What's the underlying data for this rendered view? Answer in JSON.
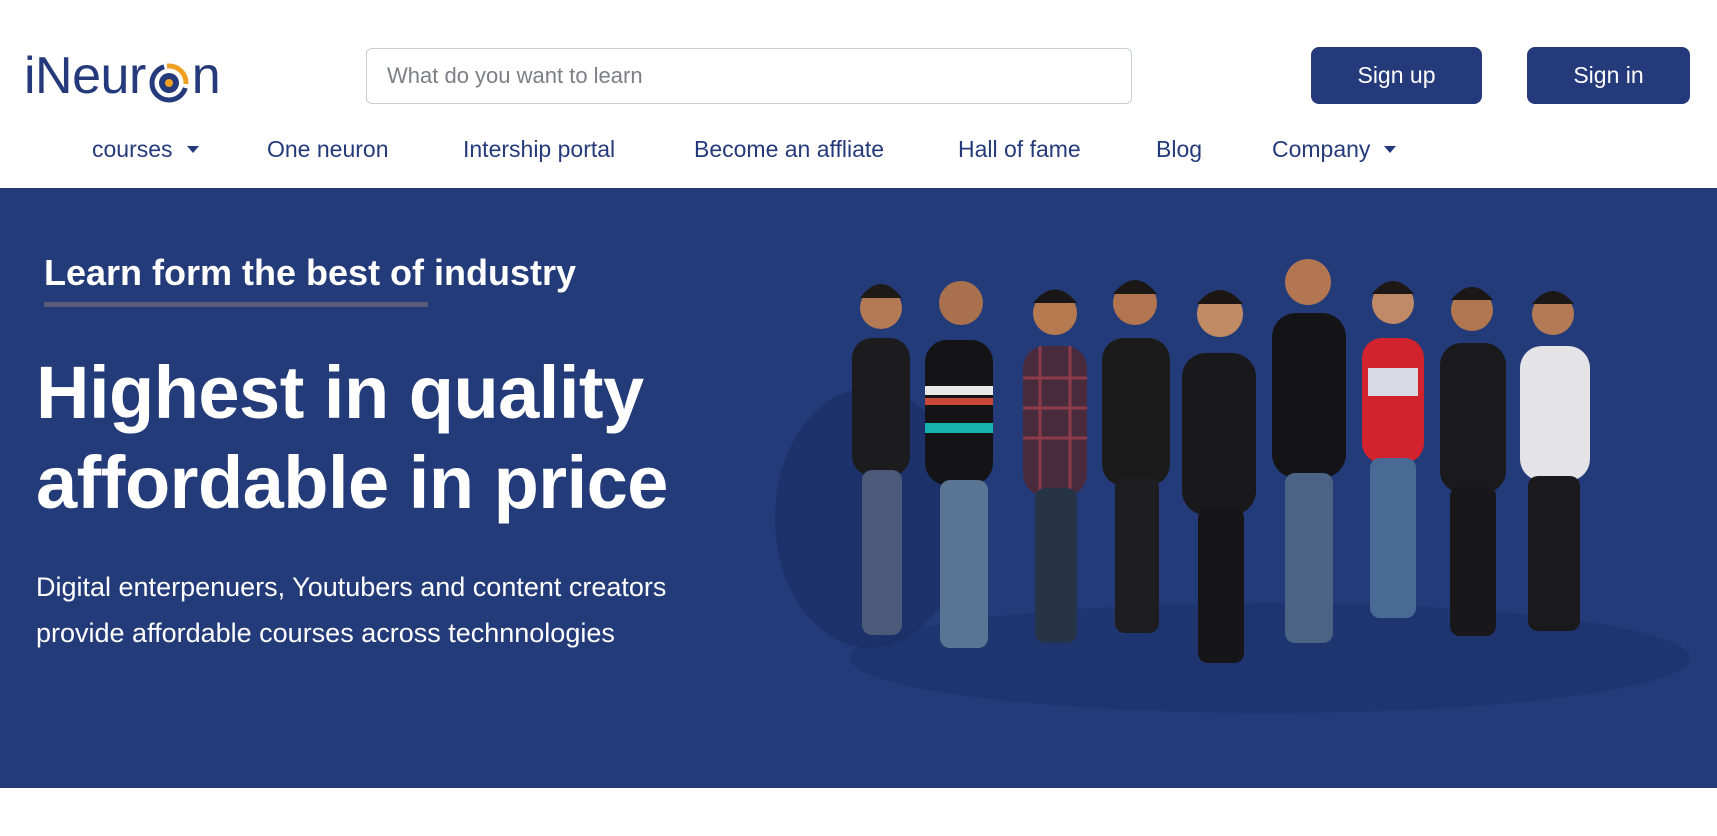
{
  "header": {
    "logo_text_prefix": "iNeur",
    "logo_text_suffix": "n",
    "search_placeholder": "What do you want to learn",
    "signup_label": "Sign up",
    "signin_label": "Sign in"
  },
  "nav": {
    "items": [
      {
        "label": "courses",
        "dropdown": true
      },
      {
        "label": "One neuron",
        "dropdown": false
      },
      {
        "label": "Intership portal",
        "dropdown": false
      },
      {
        "label": "Become an affliate",
        "dropdown": false
      },
      {
        "label": "Hall of fame",
        "dropdown": false
      },
      {
        "label": "Blog",
        "dropdown": false
      },
      {
        "label": "Company",
        "dropdown": true
      }
    ]
  },
  "hero": {
    "eyebrow": "Learn form the best of industry",
    "headline_line1": "Highest in quality",
    "headline_line2": "affordable in price",
    "subtext_line1": "Digital enterpenuers, Youtubers and content creators",
    "subtext_line2": "provide affordable courses across technnologies"
  },
  "colors": {
    "brand_navy": "#253a7a",
    "hero_background": "#233b79",
    "logo_accent_orange": "#f0a020",
    "eyebrow_underline": "#5b5a78"
  },
  "icons": {
    "logo_mark": "neuron-o-logo-icon",
    "dropdown": "caret-down-icon"
  }
}
